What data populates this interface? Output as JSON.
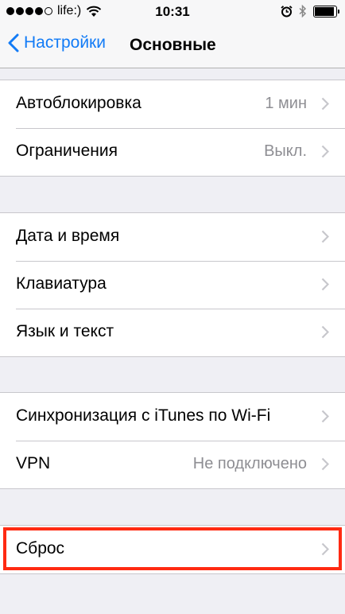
{
  "status_bar": {
    "carrier": "life:)",
    "time": "10:31"
  },
  "nav": {
    "back_label": "Настройки",
    "title": "Основные"
  },
  "groups": [
    {
      "rows": [
        {
          "label": "Автоблокировка",
          "value": "1 мин"
        },
        {
          "label": "Ограничения",
          "value": "Выкл."
        }
      ]
    },
    {
      "rows": [
        {
          "label": "Дата и время",
          "value": ""
        },
        {
          "label": "Клавиатура",
          "value": ""
        },
        {
          "label": "Язык и текст",
          "value": ""
        }
      ]
    },
    {
      "rows": [
        {
          "label": "Синхронизация с iTunes по Wi-Fi",
          "value": ""
        },
        {
          "label": "VPN",
          "value": "Не подключено"
        }
      ]
    },
    {
      "rows": [
        {
          "label": "Сброс",
          "value": ""
        }
      ]
    }
  ],
  "colors": {
    "accent": "#127bf6",
    "highlight": "#ff2a12",
    "background": "#efeff4"
  }
}
